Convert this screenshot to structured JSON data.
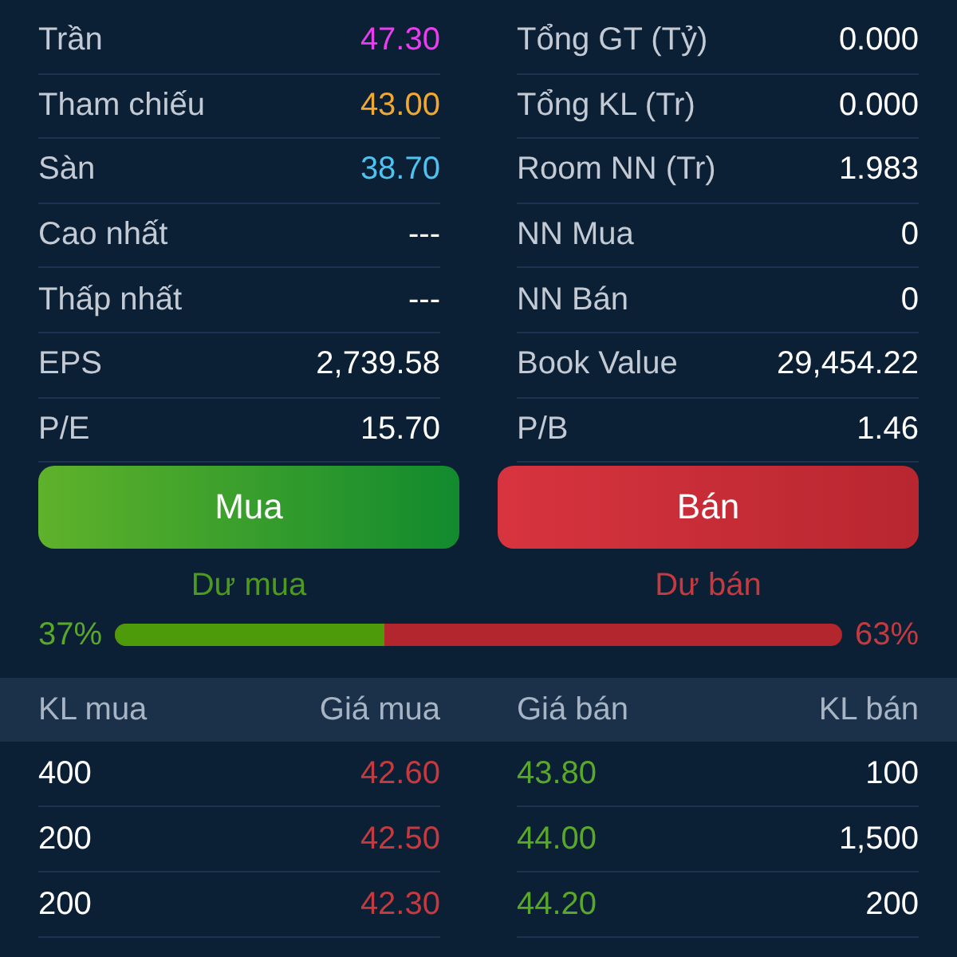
{
  "stats_left": [
    {
      "label": "Trần",
      "value": "47.30",
      "color": "#e83ef0"
    },
    {
      "label": "Tham chiếu",
      "value": "43.00",
      "color": "#f0a830"
    },
    {
      "label": "Sàn",
      "value": "38.70",
      "color": "#4ec3f0"
    },
    {
      "label": "Cao nhất",
      "value": "---"
    },
    {
      "label": "Thấp nhất",
      "value": "---"
    },
    {
      "label": "EPS",
      "value": "2,739.58"
    },
    {
      "label": "P/E",
      "value": "15.70"
    }
  ],
  "stats_right": [
    {
      "label": "Tổng GT (Tỷ)",
      "value": "0.000"
    },
    {
      "label": "Tổng KL (Tr)",
      "value": "0.000"
    },
    {
      "label": "Room NN (Tr)",
      "value": "1.983"
    },
    {
      "label": "NN Mua",
      "value": "0"
    },
    {
      "label": "NN Bán",
      "value": "0"
    },
    {
      "label": "Book Value",
      "value": "29,454.22"
    },
    {
      "label": "P/B",
      "value": "1.46"
    }
  ],
  "buttons": [
    {
      "label": "Mua",
      "kind": "buy"
    },
    {
      "label": "Bán",
      "kind": "sell"
    }
  ],
  "balance": {
    "buy_label": "Dư mua",
    "sell_label": "Dư bán",
    "buy_percent": "37%",
    "sell_percent": "63%",
    "level": 0.37
  },
  "order_book": {
    "columns": [
      "KL mua",
      "Giá mua",
      "Giá bán",
      "KL bán"
    ],
    "rows": [
      {
        "buy_volume": "400",
        "buy_price": "42.60",
        "sell_price": "43.80",
        "sell_volume": "100"
      },
      {
        "buy_volume": "200",
        "buy_price": "42.50",
        "sell_price": "44.00",
        "sell_volume": "1,500"
      },
      {
        "buy_volume": "200",
        "buy_price": "42.30",
        "sell_price": "44.20",
        "sell_volume": "200"
      }
    ]
  }
}
